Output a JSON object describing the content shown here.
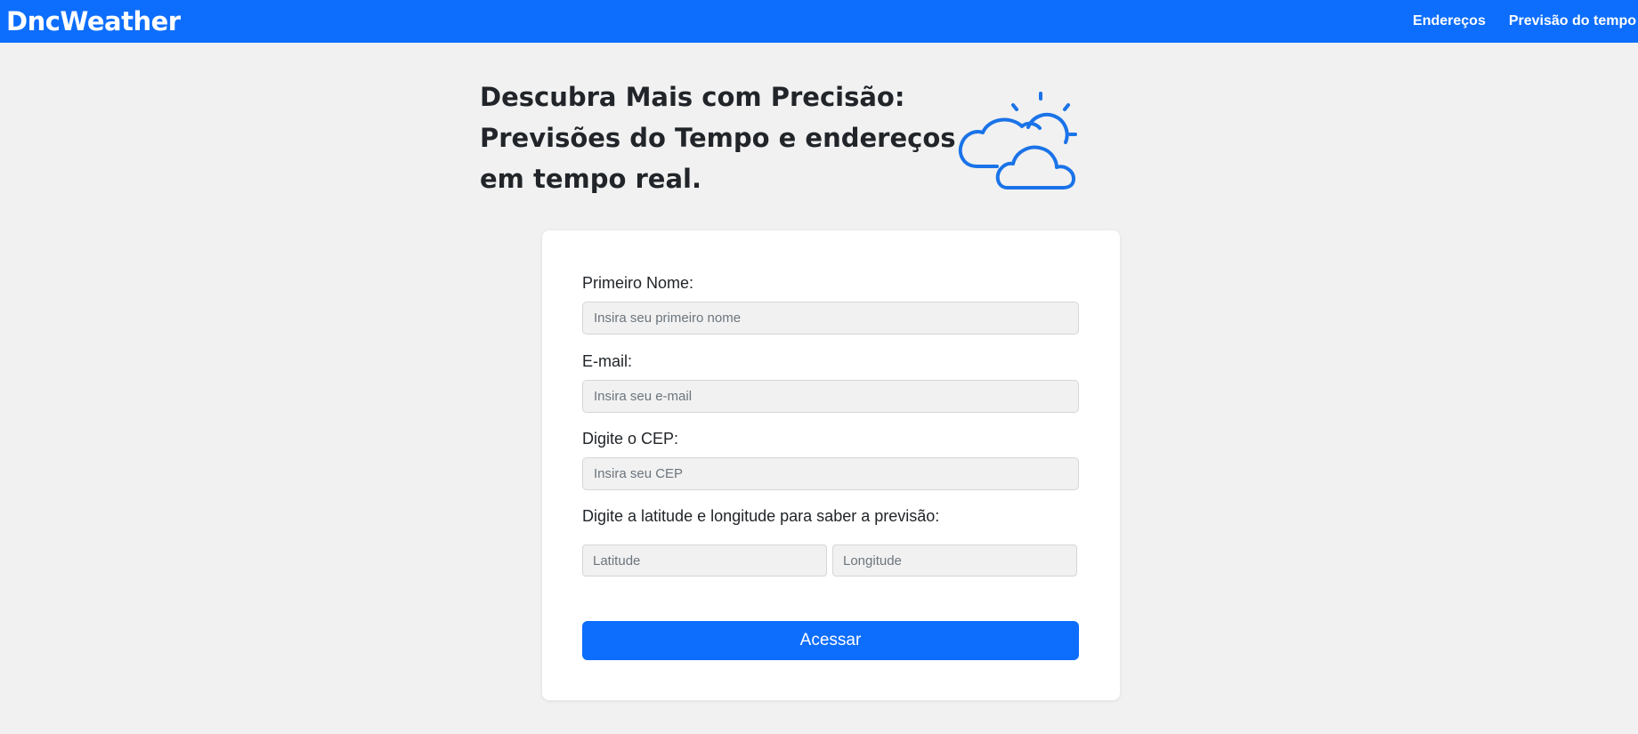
{
  "navbar": {
    "brand": "DncWeather",
    "links": [
      "Endereços",
      "Previsão do tempo"
    ]
  },
  "hero": {
    "lines": [
      "Descubra Mais com Precisão:",
      "Previsões do Tempo e endereços",
      "em tempo real."
    ],
    "icon": "partly-cloudy-icon"
  },
  "form": {
    "first_name": {
      "label": "Primeiro Nome:",
      "placeholder": "Insira seu primeiro nome",
      "value": ""
    },
    "email": {
      "label": "E-mail:",
      "placeholder": "Insira seu e-mail",
      "value": ""
    },
    "cep": {
      "label": "Digite o CEP:",
      "placeholder": "Insira seu CEP",
      "value": ""
    },
    "coords": {
      "label": "Digite a latitude e longitude para saber a previsão:",
      "latitude_placeholder": "Latitude",
      "longitude_placeholder": "Longitude"
    },
    "submit_label": "Acessar"
  },
  "colors": {
    "primary": "#0d6efd",
    "background": "#f1f1f1",
    "card": "#ffffff",
    "text": "#212529",
    "icon_stroke": "#1a73e8"
  }
}
